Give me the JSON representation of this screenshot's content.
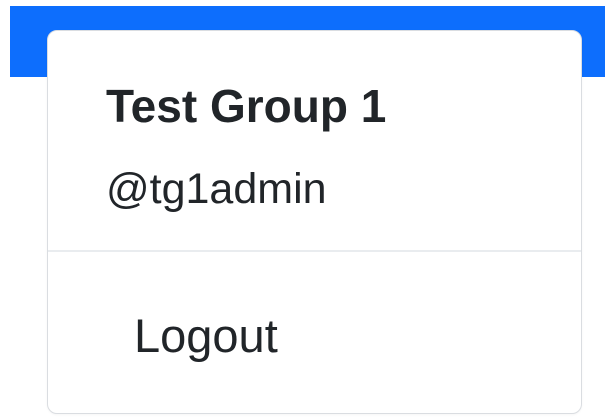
{
  "navbar": {
    "color": "#0d6efd"
  },
  "user_menu": {
    "group_name": "Test Group 1",
    "username": "@tg1admin",
    "logout_label": "Logout"
  }
}
